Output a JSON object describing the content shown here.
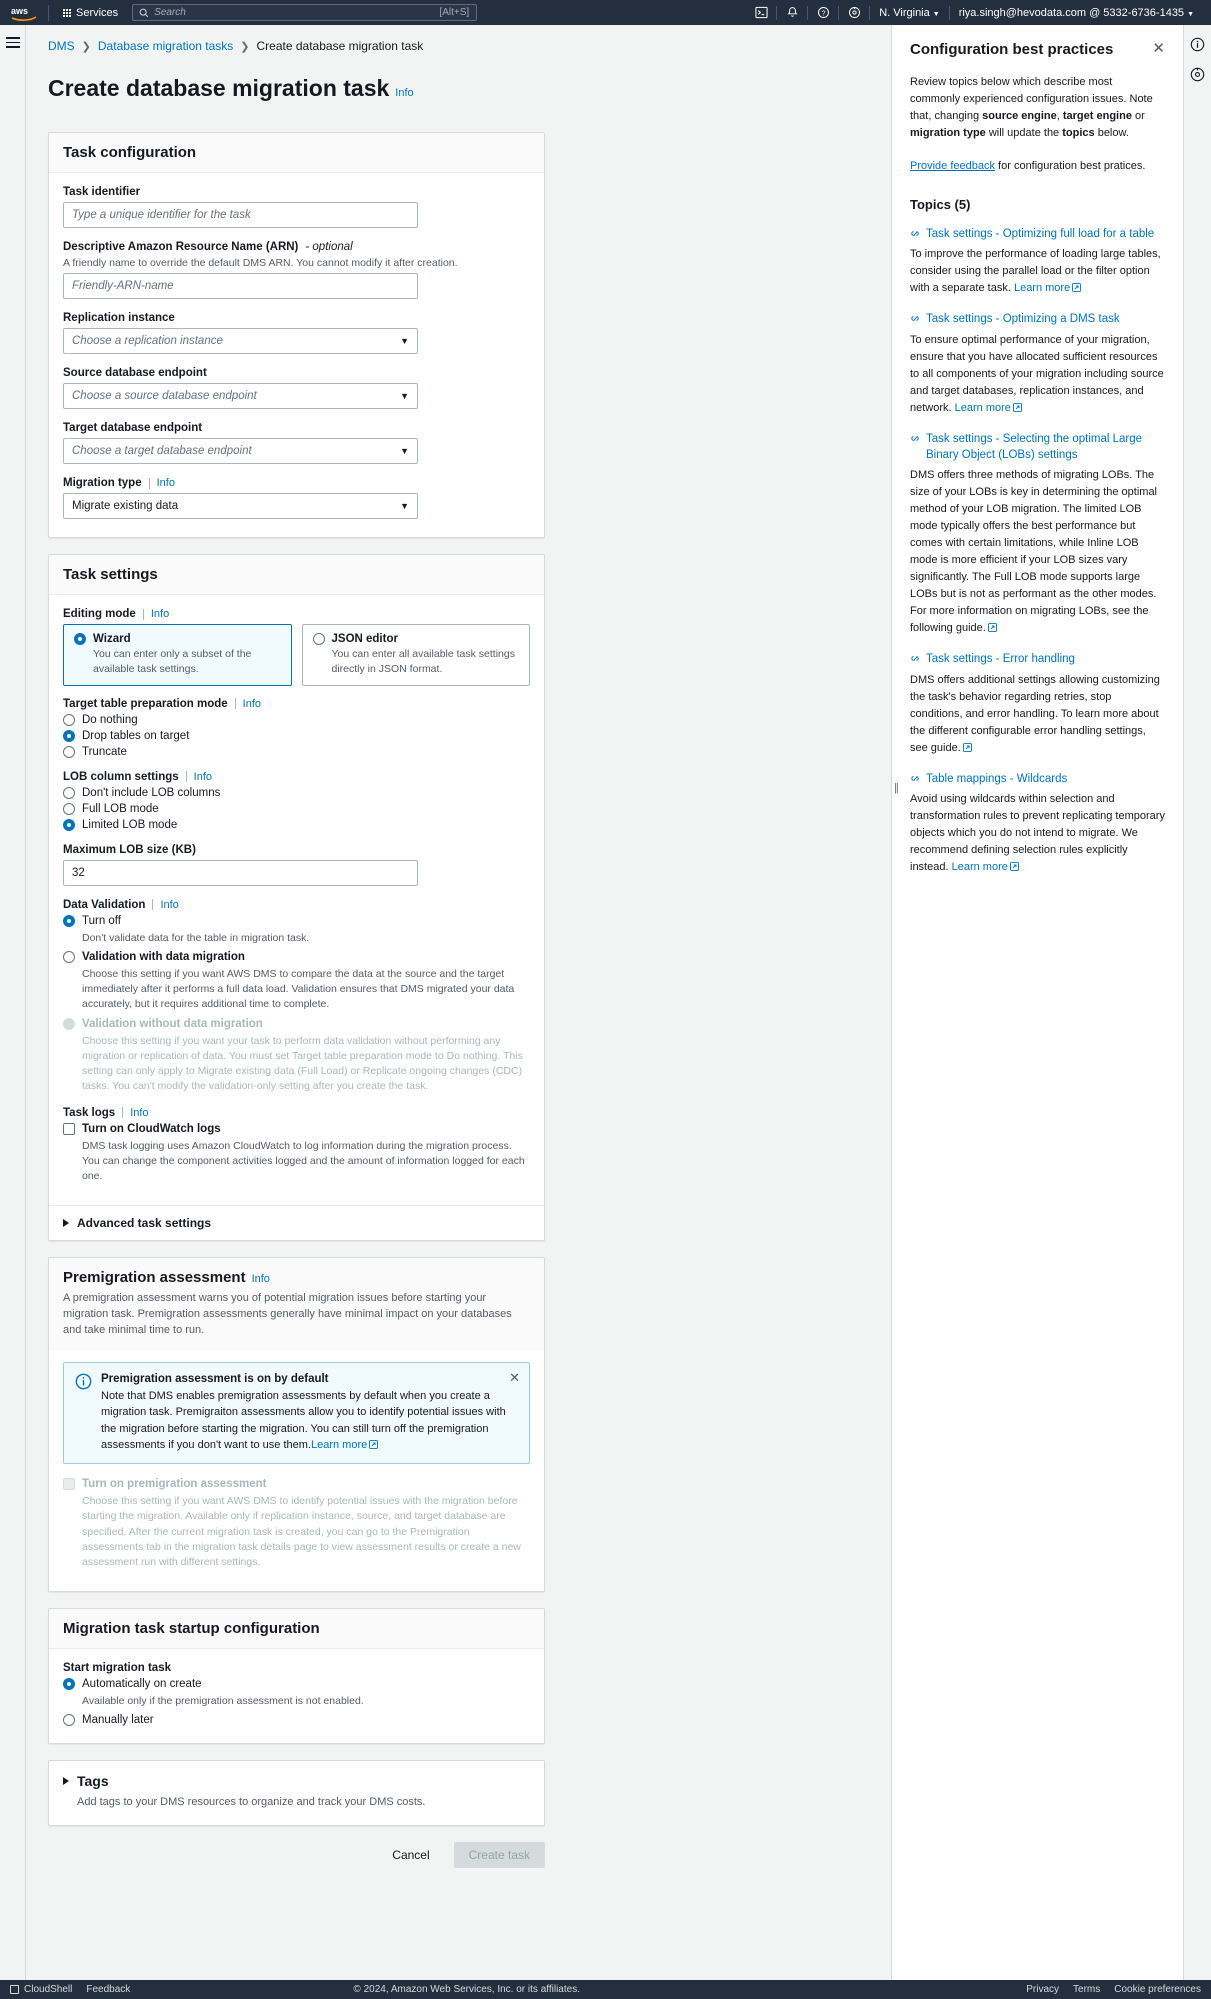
{
  "topnav": {
    "logo_alt": "aws",
    "services_label": "Services",
    "search_placeholder": "Search",
    "search_shortcut": "[Alt+S]",
    "icons": [
      "cloudshell-icon",
      "bell-icon",
      "help-circle-icon",
      "settings-gear-icon"
    ],
    "region_label": "N. Virginia",
    "account_label": "riya.singh@hevodata.com @ 5332-6736-1435"
  },
  "breadcrumb": {
    "items": [
      "DMS",
      "Database migration tasks",
      "Create database migration task"
    ]
  },
  "page": {
    "title": "Create database migration task",
    "info_label": "Info"
  },
  "task_configuration": {
    "heading": "Task configuration",
    "task_identifier": {
      "label": "Task identifier",
      "placeholder": "Type a unique identifier for the task",
      "value": ""
    },
    "arn": {
      "label": "Descriptive Amazon Resource Name (ARN)",
      "optional_suffix": "- optional",
      "hint": "A friendly name to override the default DMS ARN. You cannot modify it after creation.",
      "placeholder": "Friendly-ARN-name",
      "value": ""
    },
    "replication_instance": {
      "label": "Replication instance",
      "placeholder": "Choose a replication instance",
      "value": ""
    },
    "source_endpoint": {
      "label": "Source database endpoint",
      "placeholder": "Choose a source database endpoint",
      "value": ""
    },
    "target_endpoint": {
      "label": "Target database endpoint",
      "placeholder": "Choose a target database endpoint",
      "value": ""
    },
    "migration_type": {
      "label": "Migration type",
      "info_label": "Info",
      "value": "Migrate existing data"
    }
  },
  "task_settings": {
    "heading": "Task settings",
    "editing_mode": {
      "label": "Editing mode",
      "info_label": "Info",
      "options": [
        {
          "label": "Wizard",
          "description": "You can enter only a subset of the available task settings.",
          "selected": true
        },
        {
          "label": "JSON editor",
          "description": "You can enter all available task settings directly in JSON format.",
          "selected": false
        }
      ]
    },
    "target_table_prep": {
      "label": "Target table preparation mode",
      "info_label": "Info",
      "options": [
        {
          "label": "Do nothing",
          "selected": false
        },
        {
          "label": "Drop tables on target",
          "selected": true
        },
        {
          "label": "Truncate",
          "selected": false
        }
      ]
    },
    "lob_settings": {
      "label": "LOB column settings",
      "info_label": "Info",
      "options": [
        {
          "label": "Don't include LOB columns",
          "selected": false
        },
        {
          "label": "Full LOB mode",
          "selected": false
        },
        {
          "label": "Limited LOB mode",
          "selected": true
        }
      ]
    },
    "max_lob": {
      "label": "Maximum LOB size (KB)",
      "value": "32"
    },
    "data_validation": {
      "label": "Data Validation",
      "info_label": "Info",
      "options": [
        {
          "label": "Turn off",
          "description": "Don't validate data for the table in migration task.",
          "selected": true,
          "disabled": false
        },
        {
          "label": "Validation with data migration",
          "description": "Choose this setting if you want AWS DMS to compare the data at the source and the target immediately after it performs a full data load. Validation ensures that DMS migrated your data accurately, but it requires additional time to complete.",
          "selected": false,
          "disabled": false
        },
        {
          "label": "Validation without data migration",
          "description": "Choose this setting if you want your task to perform data validation without performing any migration or replication of data. You must set Target table preparation mode to Do nothing. This setting can only apply to Migrate existing data (Full Load) or Replicate ongoing changes (CDC) tasks. You can't modify the validation-only setting after you create the task.",
          "selected": false,
          "disabled": true
        }
      ]
    },
    "task_logs": {
      "label": "Task logs",
      "info_label": "Info",
      "checkbox_label": "Turn on CloudWatch logs",
      "checked": false,
      "description": "DMS task logging uses Amazon CloudWatch to log information during the migration process. You can change the component activities logged and the amount of information logged for each one."
    },
    "advanced_expander": "Advanced task settings"
  },
  "premigration": {
    "heading": "Premigration assessment",
    "info_label": "Info",
    "description": "A premigration assessment warns you of potential migration issues before starting your migration task. Premigration assessments generally have minimal impact on your databases and take minimal time to run.",
    "alert": {
      "title": "Premigration assessment is on by default",
      "body": "Note that DMS enables premigration assessments by default when you create a migration task. Premigraiton assessments allow you to identify potential issues with the migration before starting the migration. You can still turn off the premigration assessments if you don't want to use them.",
      "learn_more": "Learn more",
      "close_label": "close-icon"
    },
    "checkbox_label": "Turn on premigration assessment",
    "checkbox_disabled": true,
    "checkbox_description": "Choose this setting if you want AWS DMS to identify potential issues with the migration before starting the migration. Available only if replication instance, source, and target database are specified. After the current migration task is created, you can go to the Premigration assessments tab in the migration task details page to view assessment results or create a new assessment run with different settings."
  },
  "startup": {
    "heading": "Migration task startup configuration",
    "label": "Start migration task",
    "options": [
      {
        "label": "Automatically on create",
        "description": "Available only if the premigration assessment is not enabled.",
        "selected": true
      },
      {
        "label": "Manually later",
        "description": "",
        "selected": false
      }
    ]
  },
  "tags": {
    "heading": "Tags",
    "description": "Add tags to your DMS resources to organize and track your DMS costs."
  },
  "actions": {
    "cancel": "Cancel",
    "create": "Create task"
  },
  "help_panel": {
    "title": "Configuration best practices",
    "close_label": "close-icon",
    "intro_parts": [
      "Review topics below which describe most commonly experienced configuration issues. Note that, changing ",
      "source engine",
      ", ",
      "target engine",
      " or ",
      "migration type",
      " will update the ",
      "topics",
      " below."
    ],
    "feedback_link": "Provide feedback",
    "feedback_rest": " for configuration best pratices.",
    "topics_heading": "Topics (5)",
    "topics": [
      {
        "title": "Task settings - Optimizing full load for a table",
        "body": "To improve the performance of loading large tables, consider using the parallel load or the filter option with a separate task.",
        "link": "Learn more"
      },
      {
        "title": "Task settings - Optimizing a DMS task",
        "body": "To ensure optimal performance of your migration, ensure that you have allocated sufficient resources to all components of your migration including source and target databases, replication instances, and network.",
        "link": "Learn more"
      },
      {
        "title": "Task settings - Selecting the optimal Large Binary Object (LOBs) settings",
        "body": "DMS offers three methods of migrating LOBs. The size of your LOBs is key in determining the optimal method of your LOB migration. The limited LOB mode typically offers the best performance but comes with certain limitations, while Inline LOB mode is more efficient if your LOB sizes vary significantly. The Full LOB mode supports large LOBs but is not as performant as the other modes. For more information on migrating LOBs, see the following guide.",
        "link": "guide"
      },
      {
        "title": "Task settings - Error handling",
        "body": "DMS offers additional settings allowing customizing the task's behavior regarding retries, stop conditions, and error handling. To learn more about the different configurable error handling settings, see guide.",
        "link": "guide"
      },
      {
        "title": "Table mappings - Wildcards",
        "body": "Avoid using wildcards within selection and transformation rules to prevent replicating temporary objects which you do not intend to migrate. We recommend defining selection rules explicitly instead.",
        "link": "Learn more"
      }
    ]
  },
  "footer": {
    "cloudshell": "CloudShell",
    "feedback": "Feedback",
    "copyright": "© 2024, Amazon Web Services, Inc. or its affiliates.",
    "privacy": "Privacy",
    "terms": "Terms",
    "cookie": "Cookie preferences"
  }
}
